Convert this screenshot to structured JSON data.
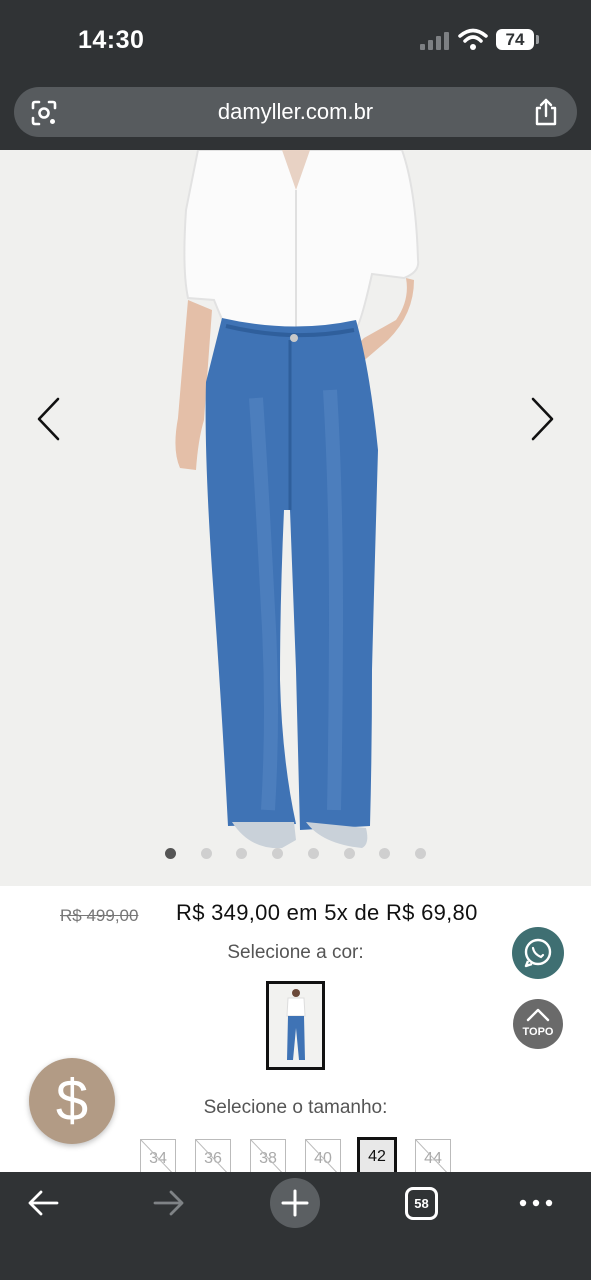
{
  "status_bar": {
    "time": "14:30",
    "battery": "74"
  },
  "browser": {
    "url": "damyller.com.br",
    "tab_count": "58"
  },
  "product": {
    "old_price": "R$ 499,00",
    "price_text": "R$ 349,00 em 5x de R$ 69,80",
    "select_color_label": "Selecione a cor:",
    "select_size_label": "Selecione o tamanho:",
    "sizes": [
      {
        "label": "34",
        "available": false
      },
      {
        "label": "36",
        "available": false
      },
      {
        "label": "38",
        "available": false
      },
      {
        "label": "40",
        "available": false
      },
      {
        "label": "42",
        "available": true,
        "selected": true
      },
      {
        "label": "44",
        "available": false
      }
    ],
    "gallery": {
      "image_count": 8,
      "active_index": 0
    }
  },
  "floating": {
    "topo_label": "TOPO",
    "dollar_symbol": "$"
  },
  "icons": {
    "lens": "google-lens-icon",
    "share": "share-icon",
    "prev": "chevron-left-icon",
    "next": "chevron-right-icon",
    "whatsapp": "whatsapp-icon",
    "back": "arrow-left-icon",
    "forward": "arrow-right-icon",
    "new_tab": "plus-icon",
    "more": "more-dots-icon"
  },
  "colors": {
    "whatsapp": "#3f6f72",
    "dollar_button": "#b29b85",
    "browser_chrome": "#303335"
  }
}
